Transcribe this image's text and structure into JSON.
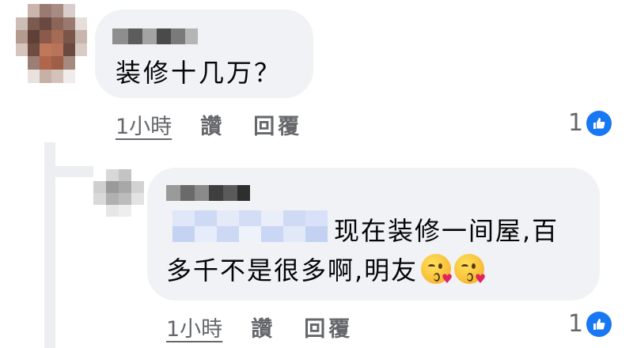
{
  "comment": {
    "text": "装修十几万？",
    "time": "1小時",
    "like_label": "讚",
    "reply_label": "回覆",
    "like_count": "1"
  },
  "reply": {
    "text_line1": "现在装修一间屋,百",
    "text_line2": "多千不是很多啊,明友",
    "emojis": [
      "kissing-heart-emoji",
      "kissing-heart-emoji"
    ],
    "time": "1小時",
    "like_label": "讚",
    "reply_label": "回覆",
    "like_count": "1"
  },
  "colors": {
    "bubble": "#f0f2f5",
    "meta_text": "#65676b",
    "like_blue": "#1877f2",
    "mention_blue": "#c9d8f6"
  }
}
